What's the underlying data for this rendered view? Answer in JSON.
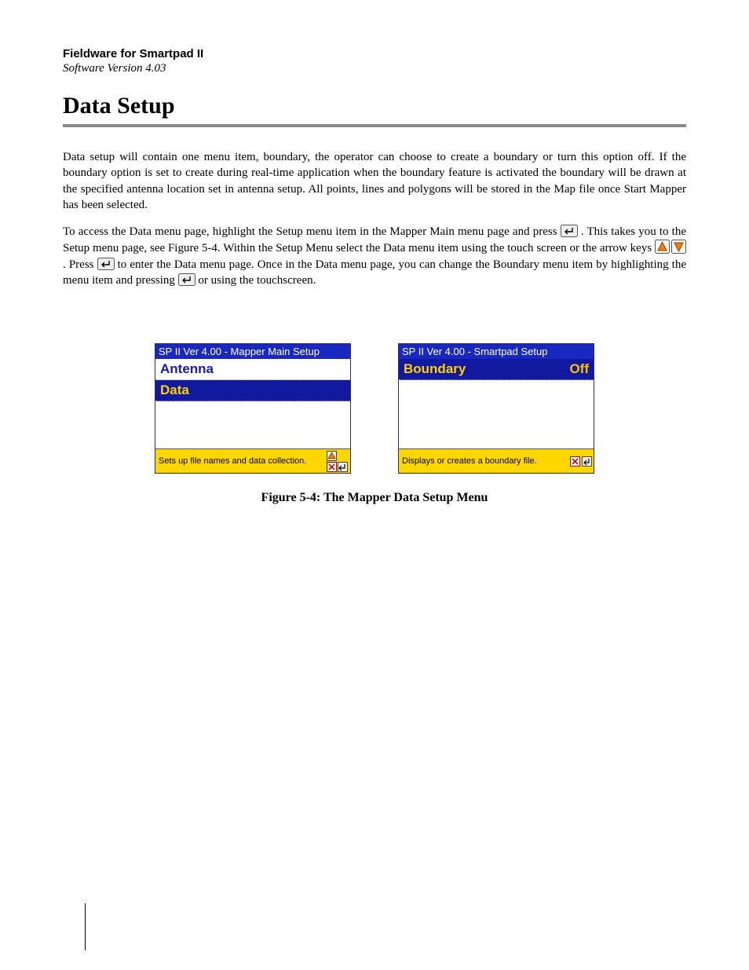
{
  "header": {
    "product": "Fieldware for Smartpad II",
    "version": "Software Version 4.03"
  },
  "title": "Data Setup",
  "paragraphs": {
    "p1": "Data setup will contain one menu item, boundary, the operator can choose to create a boundary or turn this option off. If the boundary option is set to create during real-time application when the boundary feature is activated the boundary will be drawn at the specified antenna location set in antenna setup. All points, lines and polygons will be stored in the Map file once Start Mapper has been selected.",
    "p2a": "To access the Data menu page, highlight the Setup menu item in the Mapper Main menu page and press ",
    "p2b": ". This takes you to the Setup menu page, see Figure 5-4. Within the Setup Menu select the Data menu item using the touch screen or the arrow keys ",
    "p2c": ". Press ",
    "p2d": " to enter the Data menu page. Once in the Data menu page, you can change the Boundary menu item by highlighting the menu item and pressing ",
    "p2e": " or using the touchscreen."
  },
  "screens": {
    "left": {
      "title": "SP II Ver 4.00 - Mapper Main Setup",
      "row1": "Antenna",
      "row2": "Data",
      "footer": "Sets up file names and data collection."
    },
    "right": {
      "title": "SP II Ver 4.00 - Smartpad Setup",
      "row1_label": "Boundary",
      "row1_value": "Off",
      "footer": "Displays or creates a boundary file."
    }
  },
  "caption": "Figure 5-4: The Mapper Data Setup Menu"
}
